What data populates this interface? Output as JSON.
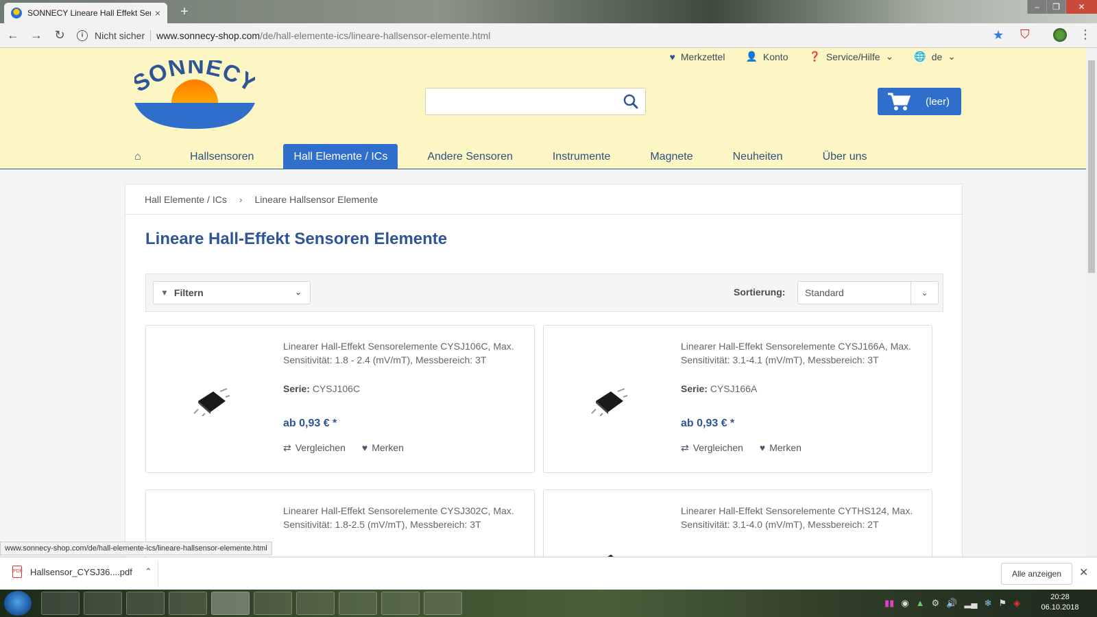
{
  "browser": {
    "tab_title": "SONNECY Lineare Hall Effekt Sen",
    "tab_close": "×",
    "new_tab": "+",
    "security": "Nicht sicher",
    "url_host": "www.sonnecy-shop.com",
    "url_path": "/de/hall-elemente-ics/lineare-hallsensor-elemente.html",
    "status_url": "www.sonnecy-shop.com/de/hall-elemente-ics/lineare-hallsensor-elemente.html"
  },
  "header": {
    "toplinks": [
      {
        "label": "Merkzettel",
        "icon": "heart-icon"
      },
      {
        "label": "Konto",
        "icon": "user-icon"
      },
      {
        "label": "Service/Hilfe",
        "icon": "help-icon"
      },
      {
        "label": "de",
        "icon": "globe-icon"
      }
    ],
    "logo_text": "SONNECY",
    "cart_label": "(leer)"
  },
  "nav": [
    "Hallsensoren",
    "Hall Elemente / ICs",
    "Andere Sensoren",
    "Instrumente",
    "Magnete",
    "Neuheiten",
    "Über uns"
  ],
  "breadcrumb": [
    "Hall Elemente / ICs",
    "Lineare Hallsensor Elemente"
  ],
  "page_title": "Lineare Hall-Effekt Sensoren Elemente",
  "filter": {
    "label": "Filtern",
    "sort_label": "Sortierung:",
    "sort_value": "Standard"
  },
  "products": [
    {
      "desc": "Linearer Hall-Effekt Sensorelemente CYSJ106C, Max. Sensitivität: 1.8 - 2.4 (mV/mT), Messbereich: 3T",
      "serie_label": "Serie:",
      "serie": "CYSJ106C",
      "price": "ab 0,93 € *",
      "compare": "Vergleichen",
      "remember": "Merken"
    },
    {
      "desc": "Linearer Hall-Effekt Sensorelemente CYSJ166A, Max. Sensitivität: 3.1-4.1 (mV/mT), Messbereich: 3T",
      "serie_label": "Serie:",
      "serie": "CYSJ166A",
      "price": "ab 0,93 € *",
      "compare": "Vergleichen",
      "remember": "Merken"
    },
    {
      "desc": "Linearer Hall-Effekt Sensorelemente CYSJ302C, Max. Sensitivität: 1.8-2.5 (mV/mT), Messbereich: 3T"
    },
    {
      "desc": "Linearer Hall-Effekt Sensorelemente CYTHS124, Max. Sensitivität: 3.1-4.0 (mV/mT), Messbereich: 2T"
    }
  ],
  "downloads": {
    "file": "Hallsensor_CYSJ36....pdf",
    "show_all": "Alle anzeigen"
  },
  "taskbar": {
    "time": "20:28",
    "date": "06.10.2018"
  },
  "colors": {
    "header_bg": "#fbf6c4",
    "accent": "#2f6ecb",
    "title": "#2f5596"
  }
}
